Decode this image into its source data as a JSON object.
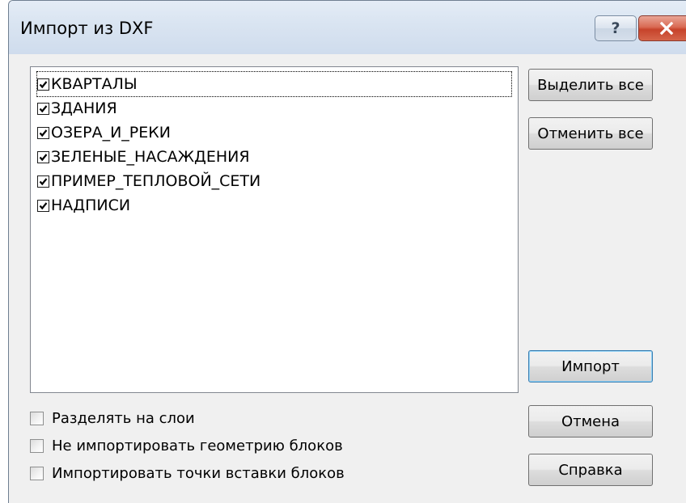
{
  "window": {
    "title": "Импорт из DXF",
    "help_label": "?"
  },
  "layers": [
    {
      "name": "КВАРТАЛЫ",
      "checked": true
    },
    {
      "name": "ЗДАНИЯ",
      "checked": true
    },
    {
      "name": "ОЗЕРА_И_РЕКИ",
      "checked": true
    },
    {
      "name": "ЗЕЛЕНЫЕ_НАСАЖДЕНИЯ",
      "checked": true
    },
    {
      "name": "ПРИМЕР_ТЕПЛОВОЙ_СЕТИ",
      "checked": true
    },
    {
      "name": "НАДПИСИ",
      "checked": true
    }
  ],
  "buttons": {
    "select_all": "Выделить все",
    "deselect_all": "Отменить все",
    "import": "Импорт",
    "cancel": "Отмена",
    "help": "Справка"
  },
  "options": [
    {
      "label": "Разделять на слои",
      "checked": false
    },
    {
      "label": "Не импортировать геометрию блоков",
      "checked": false
    },
    {
      "label": "Импортировать точки вставки блоков",
      "checked": false
    }
  ],
  "colors": {
    "titlebar": "#d9e4f1",
    "close_button": "#c7432b",
    "dialog_background": "#f0f0f0",
    "default_button_border": "#3c7fb1"
  }
}
